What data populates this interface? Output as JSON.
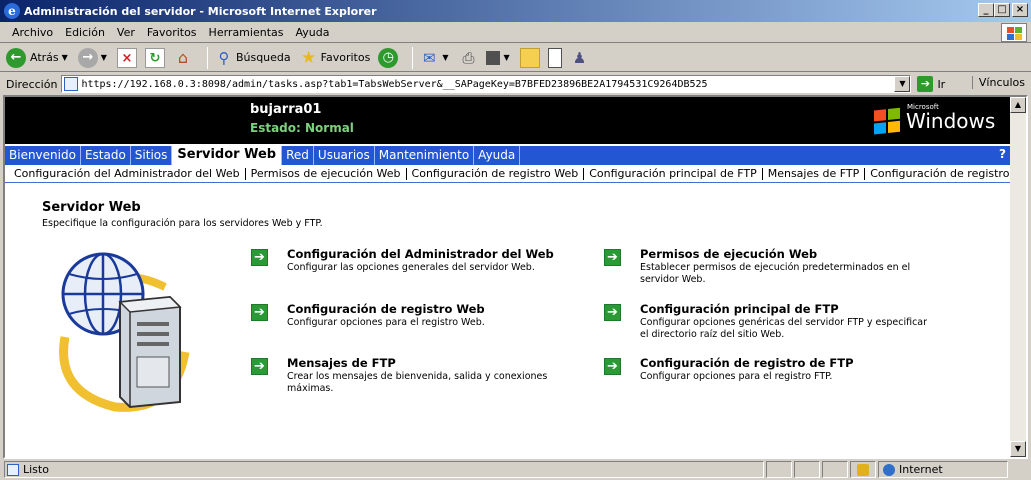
{
  "window": {
    "title": "Administración del servidor - Microsoft Internet Explorer"
  },
  "menubar": {
    "items": [
      {
        "label": "Archivo"
      },
      {
        "label": "Edición"
      },
      {
        "label": "Ver"
      },
      {
        "label": "Favoritos"
      },
      {
        "label": "Herramientas"
      },
      {
        "label": "Ayuda"
      }
    ]
  },
  "toolbar": {
    "back_label": "Atrás",
    "search_label": "Búsqueda",
    "favorites_label": "Favoritos"
  },
  "address": {
    "label": "Dirección",
    "url": "https://192.168.0.3:8098/admin/tasks.asp?tab1=TabsWebServer&__SAPageKey=B7BFED23896BE2A1794531C9264DB525",
    "go_label": "Ir",
    "links_label": "Vínculos"
  },
  "header": {
    "server_name": "bujarra01",
    "status": "Estado: Normal",
    "logo_small": "Microsoft",
    "logo_big": "Windows"
  },
  "tabs": [
    {
      "label": "Bienvenido"
    },
    {
      "label": "Estado"
    },
    {
      "label": "Sitios"
    },
    {
      "label": "Servidor Web"
    },
    {
      "label": "Red"
    },
    {
      "label": "Usuarios"
    },
    {
      "label": "Mantenimiento"
    },
    {
      "label": "Ayuda"
    }
  ],
  "help_icon": "?",
  "subtabs": [
    {
      "label": "Configuración del Administrador del Web"
    },
    {
      "label": "Permisos de ejecución Web"
    },
    {
      "label": "Configuración de registro Web"
    },
    {
      "label": "Configuración principal de FTP"
    },
    {
      "label": "Mensajes de FTP"
    },
    {
      "label": "Configuración de registro de FTP"
    }
  ],
  "page": {
    "title": "Servidor Web",
    "description": "Especifique la configuración para los servidores Web y FTP."
  },
  "tasks": [
    {
      "title": "Configuración del Administrador del Web",
      "desc": "Configurar las opciones generales del servidor Web."
    },
    {
      "title": "Permisos de ejecución Web",
      "desc": "Establecer permisos de ejecución predeterminados en el servidor Web."
    },
    {
      "title": "Configuración de registro Web",
      "desc": "Configurar opciones para el registro Web."
    },
    {
      "title": "Configuración principal de FTP",
      "desc": "Configurar opciones genéricas del servidor FTP y especificar el directorio raíz del sitio Web."
    },
    {
      "title": "Mensajes de FTP",
      "desc": "Crear los mensajes de bienvenida, salida y conexiones máximas."
    },
    {
      "title": "Configuración de registro de FTP",
      "desc": "Configurar opciones para el registro FTP."
    }
  ],
  "statusbar": {
    "status": "Listo",
    "zone": "Internet"
  },
  "colors": {
    "tab_bar": "#2356d3",
    "task_arrow": "#2a9a37",
    "status_green": "#7cd17c"
  }
}
